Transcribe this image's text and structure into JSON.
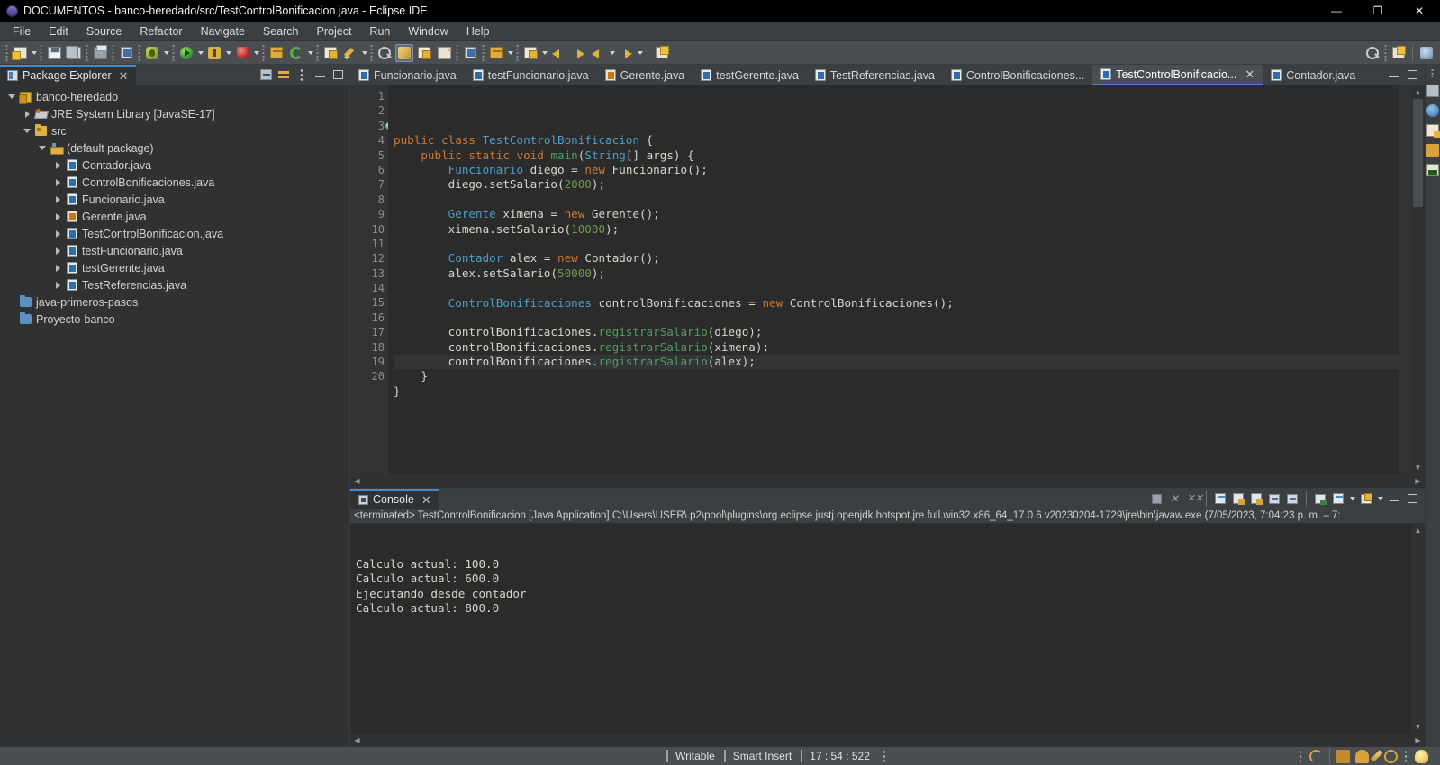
{
  "window": {
    "title": "DOCUMENTOS - banco-heredado/src/TestControlBonificacion.java - Eclipse IDE",
    "minimize": "—",
    "maximize": "❐",
    "close": "✕"
  },
  "menubar": [
    {
      "label": "File",
      "accel": "F"
    },
    {
      "label": "Edit",
      "accel": "E"
    },
    {
      "label": "Source",
      "accel": "S"
    },
    {
      "label": "Refactor",
      "accel": "t"
    },
    {
      "label": "Navigate",
      "accel": "N"
    },
    {
      "label": "Search",
      "accel": "a"
    },
    {
      "label": "Project",
      "accel": "P"
    },
    {
      "label": "Run",
      "accel": "R"
    },
    {
      "label": "Window",
      "accel": "W"
    },
    {
      "label": "Help",
      "accel": "H"
    }
  ],
  "toolbar": {
    "icons": [
      "new-wizard-icon",
      "new-dropdown-icon",
      "save-icon",
      "save-all-icon",
      "print-icon",
      "search-doc-icon",
      "debug-icon",
      "debug-dropdown-icon",
      "run-icon",
      "run-dropdown-icon",
      "coverage-icon",
      "coverage-dropdown-icon",
      "stop-icon",
      "stop-dropdown-icon",
      "new-package-icon",
      "refresh-icon",
      "refresh-dropdown-icon",
      "open-type-icon",
      "quick-fix-icon",
      "quick-fix-dropdown-icon",
      "search-icon",
      "brush-icon",
      "next-annotation-icon",
      "previous-annotation-icon",
      "toggle-marker-icon",
      "restore-icon",
      "restore-dropdown-icon",
      "last-edit-icon",
      "last-edit-dropdown-icon",
      "back-icon",
      "forward-icon",
      "previous-icon",
      "previous-dropdown-icon",
      "next-icon",
      "next-dropdown-icon",
      "perspective-icon"
    ],
    "right_icons": [
      "search-field-icon",
      "open-perspective-icon",
      "java-perspective-icon"
    ]
  },
  "package_explorer": {
    "title": "Package Explorer",
    "close": "✕",
    "tools": [
      "collapse-all-icon",
      "link-with-editor-icon",
      "view-menu-icon",
      "minimize-icon",
      "maximize-icon"
    ],
    "tree": [
      {
        "label": "banco-heredado",
        "depth": 0,
        "icon": "project-icon",
        "twisty": "open"
      },
      {
        "label": "JRE System Library",
        "suffix": "[JavaSE-17]",
        "depth": 1,
        "icon": "jre-library-icon",
        "twisty": "closed"
      },
      {
        "label": "src",
        "depth": 1,
        "icon": "source-folder-icon",
        "twisty": "open"
      },
      {
        "label": "(default package)",
        "depth": 2,
        "icon": "package-icon",
        "twisty": "open"
      },
      {
        "label": "Contador.java",
        "depth": 3,
        "icon": "java-file-icon",
        "twisty": "closed"
      },
      {
        "label": "ControlBonificaciones.java",
        "depth": 3,
        "icon": "java-file-icon",
        "twisty": "closed"
      },
      {
        "label": "Funcionario.java",
        "depth": 3,
        "icon": "java-file-icon",
        "twisty": "closed"
      },
      {
        "label": "Gerente.java",
        "depth": 3,
        "icon": "java-file-generated-icon",
        "twisty": "closed"
      },
      {
        "label": "TestControlBonificacion.java",
        "depth": 3,
        "icon": "java-file-icon",
        "twisty": "closed"
      },
      {
        "label": "testFuncionario.java",
        "depth": 3,
        "icon": "java-file-icon",
        "twisty": "closed"
      },
      {
        "label": "testGerente.java",
        "depth": 3,
        "icon": "java-file-icon",
        "twisty": "closed"
      },
      {
        "label": "TestReferencias.java",
        "depth": 3,
        "icon": "java-file-icon",
        "twisty": "closed"
      },
      {
        "label": "java-primeros-pasos",
        "depth": 0,
        "icon": "closed-project-icon",
        "twisty": "none"
      },
      {
        "label": "Proyecto-banco",
        "depth": 0,
        "icon": "closed-project-icon",
        "twisty": "none"
      }
    ]
  },
  "editor": {
    "tabs": [
      {
        "label": "Funcionario.java",
        "icon": "java-file-icon",
        "active": false
      },
      {
        "label": "testFuncionario.java",
        "icon": "java-file-icon",
        "active": false
      },
      {
        "label": "Gerente.java",
        "icon": "java-file-generated-icon",
        "active": false
      },
      {
        "label": "testGerente.java",
        "icon": "java-file-icon",
        "active": false
      },
      {
        "label": "TestReferencias.java",
        "icon": "java-file-icon",
        "active": false
      },
      {
        "label": "ControlBonificaciones...",
        "icon": "java-file-icon",
        "active": false
      },
      {
        "label": "TestControlBonificacio...",
        "icon": "java-file-icon",
        "active": true,
        "close": "✕"
      },
      {
        "label": "Contador.java",
        "icon": "java-file-icon",
        "active": false
      }
    ],
    "tools": [
      "minimize-icon",
      "maximize-icon"
    ],
    "first_line": 1,
    "line_count": 20,
    "current_line": 17,
    "breakpoint_line": 3,
    "lines": [
      {
        "n": 1,
        "tokens": []
      },
      {
        "n": 2,
        "tokens": [
          {
            "t": "public ",
            "c": "kw"
          },
          {
            "t": "class ",
            "c": "kw"
          },
          {
            "t": "TestControlBonificacion",
            "c": "type"
          },
          {
            "t": " {",
            "c": "var"
          }
        ]
      },
      {
        "n": 3,
        "tokens": [
          {
            "t": "    ",
            "c": "var"
          },
          {
            "t": "public ",
            "c": "kw"
          },
          {
            "t": "static ",
            "c": "kw"
          },
          {
            "t": "void ",
            "c": "kw"
          },
          {
            "t": "main",
            "c": "green"
          },
          {
            "t": "(",
            "c": "var"
          },
          {
            "t": "String",
            "c": "type"
          },
          {
            "t": "[] args) {",
            "c": "var"
          }
        ]
      },
      {
        "n": 4,
        "tokens": [
          {
            "t": "        ",
            "c": "var"
          },
          {
            "t": "Funcionario",
            "c": "type"
          },
          {
            "t": " diego = ",
            "c": "var"
          },
          {
            "t": "new ",
            "c": "kw"
          },
          {
            "t": "Funcionario();",
            "c": "var"
          }
        ]
      },
      {
        "n": 5,
        "tokens": [
          {
            "t": "        diego.setSalario(",
            "c": "var"
          },
          {
            "t": "2000",
            "c": "num"
          },
          {
            "t": ");",
            "c": "var"
          }
        ]
      },
      {
        "n": 6,
        "tokens": []
      },
      {
        "n": 7,
        "tokens": [
          {
            "t": "        ",
            "c": "var"
          },
          {
            "t": "Gerente",
            "c": "type"
          },
          {
            "t": " ximena = ",
            "c": "var"
          },
          {
            "t": "new ",
            "c": "kw"
          },
          {
            "t": "Gerente();",
            "c": "var"
          }
        ]
      },
      {
        "n": 8,
        "tokens": [
          {
            "t": "        ximena.setSalario(",
            "c": "var"
          },
          {
            "t": "10000",
            "c": "num"
          },
          {
            "t": ");",
            "c": "var"
          }
        ]
      },
      {
        "n": 9,
        "tokens": []
      },
      {
        "n": 10,
        "tokens": [
          {
            "t": "        ",
            "c": "var"
          },
          {
            "t": "Contador",
            "c": "type"
          },
          {
            "t": " alex = ",
            "c": "var"
          },
          {
            "t": "new ",
            "c": "kw"
          },
          {
            "t": "Contador();",
            "c": "var"
          }
        ]
      },
      {
        "n": 11,
        "tokens": [
          {
            "t": "        alex.setSalario(",
            "c": "var"
          },
          {
            "t": "50000",
            "c": "num"
          },
          {
            "t": ");",
            "c": "var"
          }
        ]
      },
      {
        "n": 12,
        "tokens": []
      },
      {
        "n": 13,
        "tokens": [
          {
            "t": "        ",
            "c": "var"
          },
          {
            "t": "ControlBonificaciones",
            "c": "type"
          },
          {
            "t": " controlBonificaciones = ",
            "c": "var"
          },
          {
            "t": "new ",
            "c": "kw"
          },
          {
            "t": "ControlBonificaciones();",
            "c": "var"
          }
        ]
      },
      {
        "n": 14,
        "tokens": []
      },
      {
        "n": 15,
        "tokens": [
          {
            "t": "        controlBonificaciones.",
            "c": "var"
          },
          {
            "t": "registrarSalario",
            "c": "green"
          },
          {
            "t": "(diego);",
            "c": "var"
          }
        ]
      },
      {
        "n": 16,
        "tokens": [
          {
            "t": "        controlBonificaciones.",
            "c": "var"
          },
          {
            "t": "registrarSalario",
            "c": "green"
          },
          {
            "t": "(ximena);",
            "c": "var"
          }
        ]
      },
      {
        "n": 17,
        "tokens": [
          {
            "t": "        controlBonificaciones.",
            "c": "var"
          },
          {
            "t": "registrarSalario",
            "c": "green"
          },
          {
            "t": "(alex);",
            "c": "var"
          }
        ],
        "caret": true
      },
      {
        "n": 18,
        "tokens": [
          {
            "t": "    }",
            "c": "var"
          }
        ]
      },
      {
        "n": 19,
        "tokens": [
          {
            "t": "}",
            "c": "var"
          }
        ]
      },
      {
        "n": 20,
        "tokens": []
      }
    ]
  },
  "console": {
    "tab_label": "Console",
    "tab_close": "✕",
    "tools": [
      "terminate-icon",
      "remove-launch-icon",
      "remove-all-terminated-icon",
      "clear-console-icon",
      "scroll-lock-icon",
      "pin-console-icon",
      "display-selected-console-icon",
      "open-console-icon",
      "new-console-view-icon",
      "console-dropdown-icon",
      "minimize-icon",
      "maximize-icon"
    ],
    "status_line": "<terminated> TestControlBonificacion [Java Application] C:\\Users\\USER\\.p2\\pool\\plugins\\org.eclipse.justj.openjdk.hotspot.jre.full.win32.x86_64_17.0.6.v20230204-1729\\jre\\bin\\javaw.exe  (7/05/2023, 7:04:23 p. m. – 7:",
    "output": [
      "Calculo actual: 100.0",
      "Calculo actual: 600.0",
      "Ejecutando desde contador",
      "Calculo actual: 800.0"
    ]
  },
  "right_rail": {
    "icons": [
      "outline-view-icon",
      "javadoc-view-icon",
      "problems-view-icon",
      "tasks-view-icon",
      "console-view-icon"
    ]
  },
  "statusbar": {
    "writable": "Writable",
    "insert_mode": "Smart Insert",
    "position": "17 : 54 : 522",
    "icons": [
      "undo-icon",
      "book-icon",
      "hat-icon",
      "pen-icon",
      "at-icon",
      "bulb-icon"
    ]
  },
  "colors": {
    "accent": "#4a88c7",
    "editor_bg": "#2b2b2b",
    "keyword": "#cc7832",
    "type": "#4e9ec6",
    "number": "#6a9c4f",
    "method": "#4f9e5e",
    "chrome": "#3c3f41"
  }
}
